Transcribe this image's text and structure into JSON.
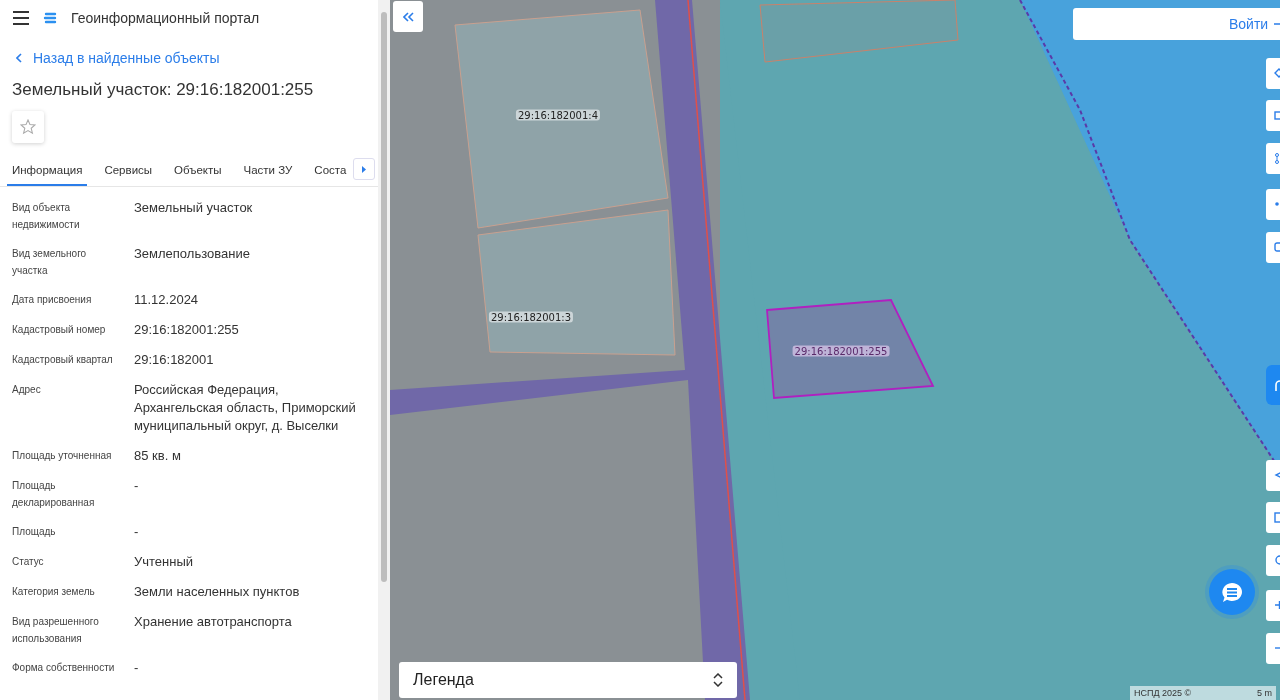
{
  "header": {
    "title": "Геоинформационный портал"
  },
  "back_link": "Назад в найденные объекты",
  "object_title": "Земельный участок: 29:16:182001:255",
  "favorite": {
    "on": false
  },
  "tabs": [
    {
      "label": "Информация",
      "selected": true
    },
    {
      "label": "Сервисы",
      "selected": false
    },
    {
      "label": "Объекты",
      "selected": false
    },
    {
      "label": "Части ЗУ",
      "selected": false
    },
    {
      "label": "Соста",
      "selected": false
    }
  ],
  "properties": [
    {
      "label": "Вид объекта недвижимости",
      "value": "Земельный участок"
    },
    {
      "label": "Вид земельного участка",
      "value": "Землепользование"
    },
    {
      "label": "Дата присвоения",
      "value": "11.12.2024"
    },
    {
      "label": "Кадастровый номер",
      "value": "29:16:182001:255"
    },
    {
      "label": "Кадастровый квартал",
      "value": "29:16:182001"
    },
    {
      "label": "Адрес",
      "value": "Российская Федерация, Архангельская область, Приморский муниципальный округ, д. Выселки"
    },
    {
      "label": "Площадь уточненная",
      "value": "85 кв. м"
    },
    {
      "label": "Площадь декларированная",
      "value": "-"
    },
    {
      "label": "Площадь",
      "value": "-"
    },
    {
      "label": "Статус",
      "value": "Учтенный"
    },
    {
      "label": "Категория земель",
      "value": "Земли населенных пунктов"
    },
    {
      "label": "Вид разрешенного использования",
      "value": "Хранение автотранспорта"
    },
    {
      "label": "Форма собственности",
      "value": "-"
    }
  ],
  "map": {
    "login_button": "Войти",
    "parcels": [
      {
        "label": "29:16:182001:4",
        "selected": false
      },
      {
        "label": "29:16:182001:3",
        "selected": false
      },
      {
        "label": "29:16:182001:255",
        "selected": true
      }
    ],
    "legend": "Легенда",
    "attribution": "НСПД 2025 ©",
    "scale": "5 m"
  }
}
